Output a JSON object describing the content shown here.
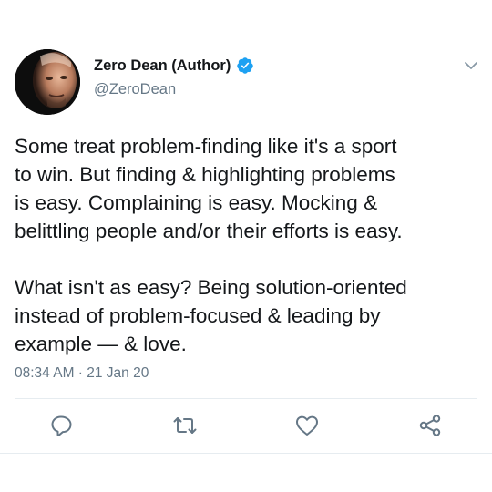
{
  "author": {
    "display_name": "Zero Dean (Author)",
    "handle": "@ZeroDean",
    "verified": true
  },
  "tweet": {
    "text": "Some treat problem-finding like it's a sport\nto win. But finding & highlighting problems\nis easy. Complaining is easy. Mocking &\nbelittling people and/or their efforts is easy.\n\nWhat isn't as easy? Being solution-oriented\ninstead of problem-focused & leading by\nexample — & love.",
    "timestamp": "08:34 AM · 21 Jan 20"
  },
  "icons": {
    "more": "chevron-down-icon",
    "reply": "reply-icon",
    "retweet": "retweet-icon",
    "like": "heart-icon",
    "share": "share-icon"
  },
  "colors": {
    "verified": "#1da1f2",
    "icon": "#657786",
    "text": "#14171a",
    "secondary": "#657786"
  }
}
